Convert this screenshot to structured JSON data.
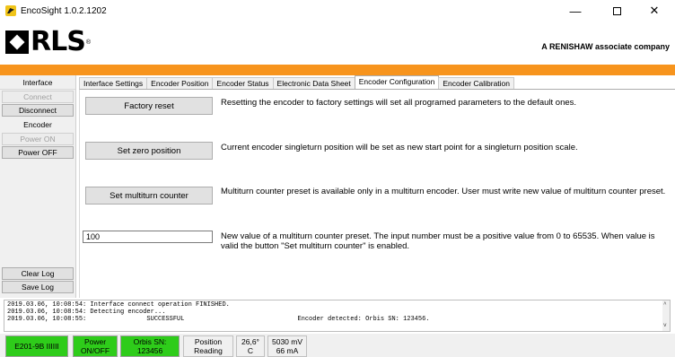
{
  "window": {
    "title": "EncoSight 1.0.2.1202",
    "minimize": "—",
    "close": "✕"
  },
  "header": {
    "logo_text": "RLS",
    "logo_reg": "®",
    "associate_prefix": "A ",
    "associate_brand": "RENISHAW",
    "associate_suffix": " associate company"
  },
  "colors": {
    "accent_orange": "#f7941d",
    "status_green": "#2ecc1a"
  },
  "sidebar": {
    "interface_label": "Interface",
    "connect": "Connect",
    "disconnect": "Disconnect",
    "encoder_label": "Encoder",
    "power_on": "Power ON",
    "power_off": "Power OFF",
    "clear_log": "Clear Log",
    "save_log": "Save Log"
  },
  "tabs": [
    {
      "label": "Interface Settings"
    },
    {
      "label": "Encoder Position"
    },
    {
      "label": "Encoder Status"
    },
    {
      "label": "Electronic Data Sheet"
    },
    {
      "label": "Encoder Configuration"
    },
    {
      "label": "Encoder Calibration"
    }
  ],
  "config": {
    "factory_reset_label": "Factory reset",
    "factory_reset_desc": "Resetting the encoder to factory settings will set all programed parameters to the default ones.",
    "set_zero_label": "Set zero position",
    "set_zero_desc": "Current encoder singleturn position will be set as new start point for a singleturn position scale.",
    "set_multiturn_label": "Set multiturn counter",
    "set_multiturn_desc": "Multiturn counter preset is available only in a multiturn encoder. User must write new value of multiturn counter preset.",
    "preset_value": "100",
    "preset_desc": "New value of a multiturn counter preset. The input number must be a positive value from 0 to 65535. When value is valid the button \"Set multiturn counter\" is enabled."
  },
  "log": {
    "lines": [
      "2019.03.06, 10:08:54: Interface connect operation FINISHED.",
      "2019.03.06, 10:08:54: Detecting encoder...",
      "2019.03.06, 10:08:55:                SUCCESSFUL                              Encoder detected: Orbis SN: 123456."
    ]
  },
  "status": {
    "interface": "E201-9B IIIIII",
    "power_line1": "Power",
    "power_line2": "ON/OFF",
    "sn_line1": "Orbis SN:",
    "sn_line2": "123456",
    "pos_line1": "Position",
    "pos_line2": "Reading",
    "temp_line1": "26,6°",
    "temp_line2": "C",
    "volt_line1": "5030 mV",
    "volt_line2": "66 mA"
  }
}
